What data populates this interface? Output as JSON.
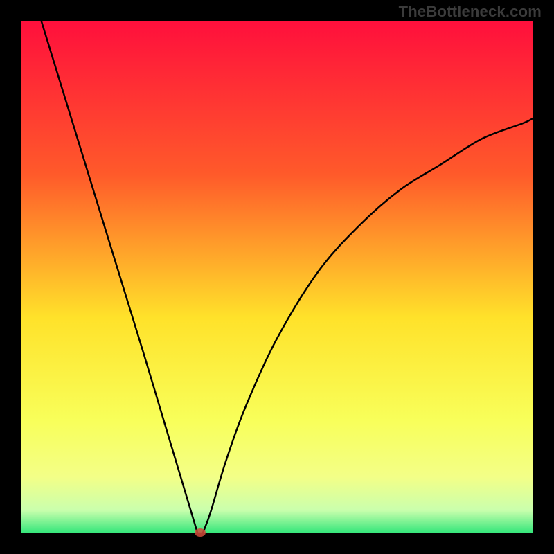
{
  "watermark": "TheBottleneck.com",
  "chart_data": {
    "type": "line",
    "title": "",
    "xlabel": "",
    "ylabel": "",
    "xlim": [
      0,
      100
    ],
    "ylim": [
      0,
      100
    ],
    "curve_left": {
      "x": [
        4,
        8,
        12,
        16,
        20,
        24,
        27,
        30,
        33,
        34.5
      ],
      "y": [
        100,
        87,
        74,
        61,
        48,
        35,
        25,
        15,
        5,
        0
      ]
    },
    "curve_right": {
      "x": [
        35.5,
        37,
        40,
        44,
        50,
        58,
        66,
        74,
        82,
        90,
        98,
        100
      ],
      "y": [
        0,
        4,
        14,
        25,
        38,
        51,
        60,
        67,
        72,
        77,
        80,
        81
      ]
    },
    "marker": {
      "x": 35,
      "y": 0,
      "color": "#d24a3a"
    },
    "green_band": {
      "from_y": 0,
      "to_y": 3
    },
    "yellow_band": {
      "from_y": 3,
      "to_y": 12
    },
    "gradient": {
      "top": "#ff0f3c",
      "mid1": "#ff8a2a",
      "mid2": "#ffe22a",
      "yellow": "#f8ff5a",
      "green": "#32e67a"
    }
  }
}
